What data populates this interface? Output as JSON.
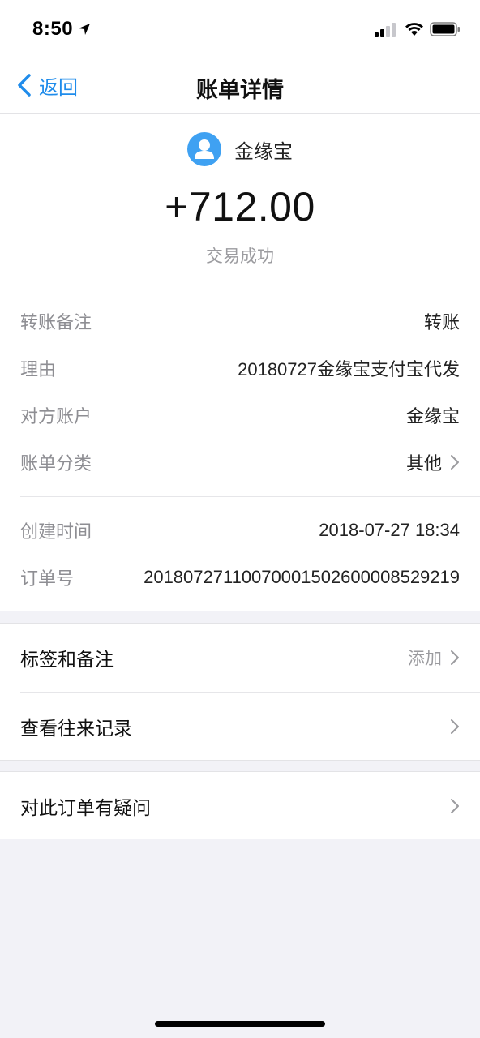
{
  "status_bar": {
    "time": "8:50"
  },
  "nav": {
    "back_label": "返回",
    "title": "账单详情"
  },
  "payee": {
    "name": "金缘宝",
    "amount": "+712.00",
    "status": "交易成功"
  },
  "details": {
    "transfer_note": {
      "label": "转账备注",
      "value": "转账"
    },
    "reason": {
      "label": "理由",
      "value": "20180727金缘宝支付宝代发"
    },
    "counterparty": {
      "label": "对方账户",
      "value": "金缘宝"
    },
    "category": {
      "label": "账单分类",
      "value": "其他"
    },
    "created_time": {
      "label": "创建时间",
      "value": "2018-07-27 18:34"
    },
    "order_no": {
      "label": "订单号",
      "value": "20180727110070001502600008529219"
    }
  },
  "actions": {
    "tags_notes": {
      "label": "标签和备注",
      "value": "添加"
    },
    "history": {
      "label": "查看往来记录"
    },
    "question": {
      "label": "对此订单有疑问"
    }
  },
  "colors": {
    "accent": "#1F8CEB",
    "avatar": "#3FA1F2",
    "background": "#F2F2F7"
  }
}
